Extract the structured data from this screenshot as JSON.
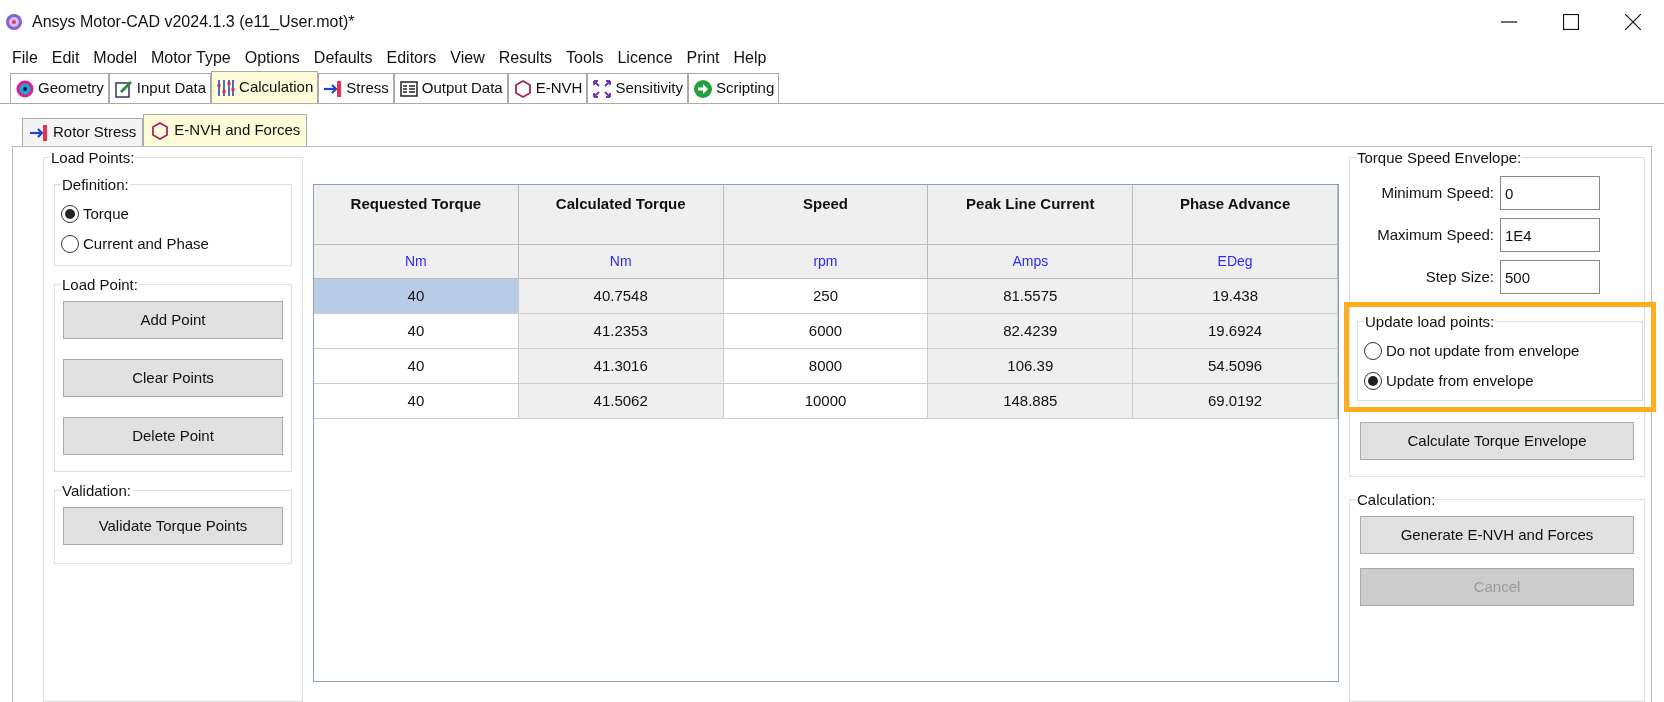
{
  "window": {
    "title": "Ansys Motor-CAD v2024.1.3 (e11_User.mot)*"
  },
  "menu": [
    "File",
    "Edit",
    "Model",
    "Motor Type",
    "Options",
    "Defaults",
    "Editors",
    "View",
    "Results",
    "Tools",
    "Licence",
    "Print",
    "Help"
  ],
  "tabs": [
    {
      "label": "Geometry",
      "kind": "geometry",
      "selected": false
    },
    {
      "label": "Input Data",
      "kind": "input",
      "selected": false
    },
    {
      "label": "Calculation",
      "kind": "calculation",
      "selected": true
    },
    {
      "label": "Stress",
      "kind": "stress",
      "selected": false
    },
    {
      "label": "Output Data",
      "kind": "output",
      "selected": false
    },
    {
      "label": "E-NVH",
      "kind": "envh",
      "selected": false
    },
    {
      "label": "Sensitivity",
      "kind": "sensitivity",
      "selected": false
    },
    {
      "label": "Scripting",
      "kind": "scripting",
      "selected": false
    }
  ],
  "subtabs": [
    {
      "label": "Rotor Stress",
      "kind": "stress",
      "selected": false
    },
    {
      "label": "E-NVH and Forces",
      "kind": "envh",
      "selected": true
    }
  ],
  "load_points": {
    "title": "Load Points:",
    "definition": {
      "title": "Definition:",
      "options": [
        {
          "label": "Torque",
          "selected": true
        },
        {
          "label": "Current and Phase",
          "selected": false
        }
      ]
    },
    "load_point": {
      "title": "Load Point:",
      "buttons": [
        "Add Point",
        "Clear Points",
        "Delete Point"
      ]
    },
    "validation": {
      "title": "Validation:",
      "buttons": [
        "Validate Torque Points"
      ]
    }
  },
  "table": {
    "columns": [
      {
        "name": "Requested Torque",
        "unit": "Nm",
        "readonly": false
      },
      {
        "name": "Calculated Torque",
        "unit": "Nm",
        "readonly": true
      },
      {
        "name": "Speed",
        "unit": "rpm",
        "readonly": false
      },
      {
        "name": "Peak Line Current",
        "unit": "Amps",
        "readonly": true
      },
      {
        "name": "Phase Advance",
        "unit": "EDeg",
        "readonly": true
      }
    ],
    "rows": [
      {
        "cells": [
          "40",
          "40.7548",
          "250",
          "81.5575",
          "19.438"
        ],
        "selected": true
      },
      {
        "cells": [
          "40",
          "41.2353",
          "6000",
          "82.4239",
          "19.6924"
        ],
        "selected": false
      },
      {
        "cells": [
          "40",
          "41.3016",
          "8000",
          "106.39",
          "54.5096"
        ],
        "selected": false
      },
      {
        "cells": [
          "40",
          "41.5062",
          "10000",
          "148.885",
          "69.0192"
        ],
        "selected": false
      }
    ]
  },
  "envelope": {
    "title": "Torque Speed Envelope:",
    "fields": [
      {
        "label": "Minimum Speed:",
        "value": "0"
      },
      {
        "label": "Maximum Speed:",
        "value": "1E4"
      },
      {
        "label": "Step Size:",
        "value": "500"
      }
    ],
    "update": {
      "title": "Update load points:",
      "highlighted": true,
      "options": [
        {
          "label": "Do not update from envelope",
          "selected": false
        },
        {
          "label": "Update from envelope",
          "selected": true
        }
      ]
    },
    "button": "Calculate Torque Envelope"
  },
  "calculation": {
    "title": "Calculation:",
    "buttons": [
      {
        "label": "Generate E-NVH and Forces",
        "disabled": false
      },
      {
        "label": "Cancel",
        "disabled": true
      }
    ]
  }
}
